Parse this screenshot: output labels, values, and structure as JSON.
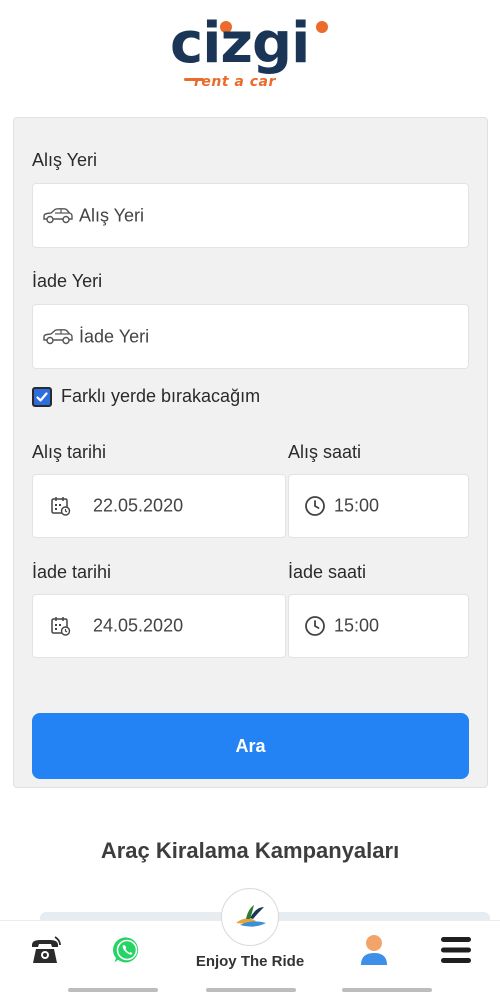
{
  "brand": {
    "name": "cizgi",
    "tagline": "rent a car"
  },
  "form": {
    "pickup_location_label": "Alış Yeri",
    "pickup_location_placeholder": "Alış Yeri",
    "return_location_label": "İade Yeri",
    "return_location_placeholder": "İade Yeri",
    "different_return_label": "Farklı yerde bırakacağım",
    "different_return_checked": true,
    "pickup_date_label": "Alış tarihi",
    "pickup_date_value": "22.05.2020",
    "pickup_time_label": "Alış saati",
    "pickup_time_value": "15:00",
    "return_date_label": "İade tarihi",
    "return_date_value": "24.05.2020",
    "return_time_label": "İade saati",
    "return_time_value": "15:00",
    "search_button_label": "Ara"
  },
  "campaigns": {
    "title": "Araç Kiralama Kampanyaları"
  },
  "bottom_nav": {
    "phone_icon": "phone-icon",
    "whatsapp_icon": "whatsapp-icon",
    "center_label": "Enjoy The Ride",
    "profile_icon": "user-icon",
    "menu_icon": "hamburger-menu-icon"
  },
  "colors": {
    "brand_navy": "#1b3557",
    "brand_orange": "#ec6a2a",
    "accent_blue": "#2383f4",
    "whatsapp_green": "#25d366"
  }
}
